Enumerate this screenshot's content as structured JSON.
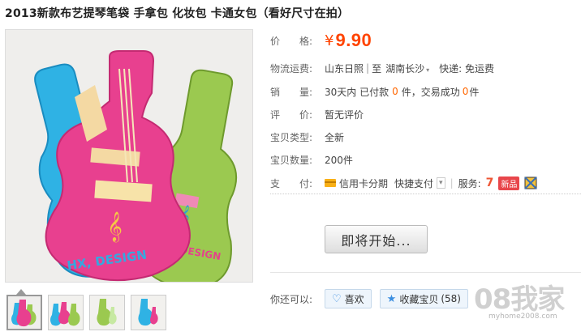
{
  "title": "2013新款布艺提琴笔袋 手拿包 化妆包 卡通女包（看好尺寸在拍）",
  "product_image": {
    "brand_print": "HX, DESIGN"
  },
  "thumbnails": [
    {
      "name": "thumb-1"
    },
    {
      "name": "thumb-2"
    },
    {
      "name": "thumb-3"
    },
    {
      "name": "thumb-4"
    }
  ],
  "price": {
    "label": "价 格:",
    "currency": "¥",
    "value": "9.90"
  },
  "shipping": {
    "label": "物流运费:",
    "from": "山东日照",
    "to_word": "至",
    "to": "湖南长沙",
    "express": "快递: 免运费"
  },
  "sales": {
    "label": "销 量:",
    "prefix": "30天内 已付款",
    "paid_count": "0",
    "mid": "件，交易成功",
    "success_count": "0",
    "suffix": "件"
  },
  "review": {
    "label": "评 价:",
    "value": "暂无评价"
  },
  "type": {
    "label": "宝贝类型:",
    "value": "全新"
  },
  "stock": {
    "label": "宝贝数量:",
    "value": "200件"
  },
  "payment": {
    "label": "支 付:",
    "credit": "信用卡分期",
    "quick": "快捷支付",
    "service_label": "服务:",
    "new_badge": "新品"
  },
  "buy_button": "即将开始...",
  "share": {
    "label": "你还可以:",
    "like": "喜欢",
    "collect": "收藏宝贝",
    "collect_count": "(58)"
  },
  "watermark": {
    "text": "08我家",
    "url": "myhome2008.com"
  },
  "colors": {
    "price": "#ff4400",
    "count": "#ff6600",
    "guitar_pink": "#e8408f",
    "guitar_blue": "#34b6e6",
    "guitar_green": "#9ccb4e"
  }
}
